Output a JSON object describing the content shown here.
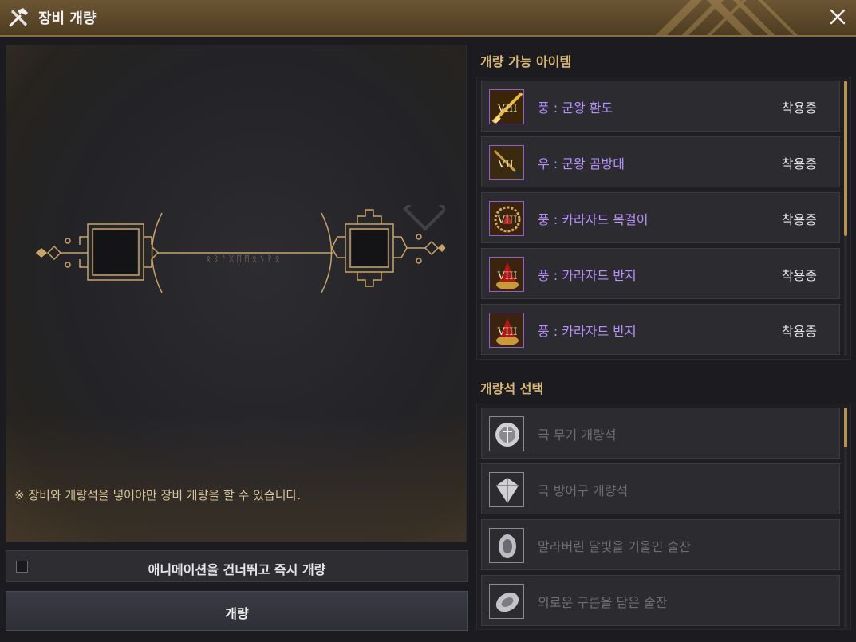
{
  "window": {
    "title": "장비 개량",
    "close_label": "✕"
  },
  "left": {
    "notice": "※ 장비와 개량석을 넣어야만 장비 개량을 할 수 있습니다.",
    "skip_animation_label": "애니메이션을 건너뛰고 즉시 개량",
    "skip_animation_checked": false,
    "upgrade_button_label": "개량"
  },
  "upgradable": {
    "title": "개량 가능 아이템",
    "items": [
      {
        "name": "풍 : 군왕 환도",
        "status": "착용중",
        "tier": "VIII",
        "icon": "sword-icon"
      },
      {
        "name": "우 : 군왕 곰방대",
        "status": "착용중",
        "tier": "VII",
        "icon": "pipe-icon"
      },
      {
        "name": "풍 : 카라자드 목걸이",
        "status": "착용중",
        "tier": "VIII",
        "icon": "necklace-icon"
      },
      {
        "name": "풍 : 카라자드 반지",
        "status": "착용중",
        "tier": "VIII",
        "icon": "ring-icon"
      },
      {
        "name": "풍 : 카라자드 반지",
        "status": "착용중",
        "tier": "VIII",
        "icon": "ring-icon"
      }
    ]
  },
  "stones": {
    "title": "개량석 선택",
    "items": [
      {
        "name": "극 무기 개량석",
        "icon": "weapon-stone-icon"
      },
      {
        "name": "극 방어구 개량석",
        "icon": "armor-stone-icon"
      },
      {
        "name": "말라버린 달빛을 기울인 술잔",
        "icon": "moonlight-cup-icon"
      },
      {
        "name": "외로운 구름을 담은 술잔",
        "icon": "cloud-cup-icon"
      }
    ]
  },
  "colors": {
    "accent_gold": "#d9b877",
    "item_purple": "#b890ff",
    "title_bar": "#5a4628"
  }
}
